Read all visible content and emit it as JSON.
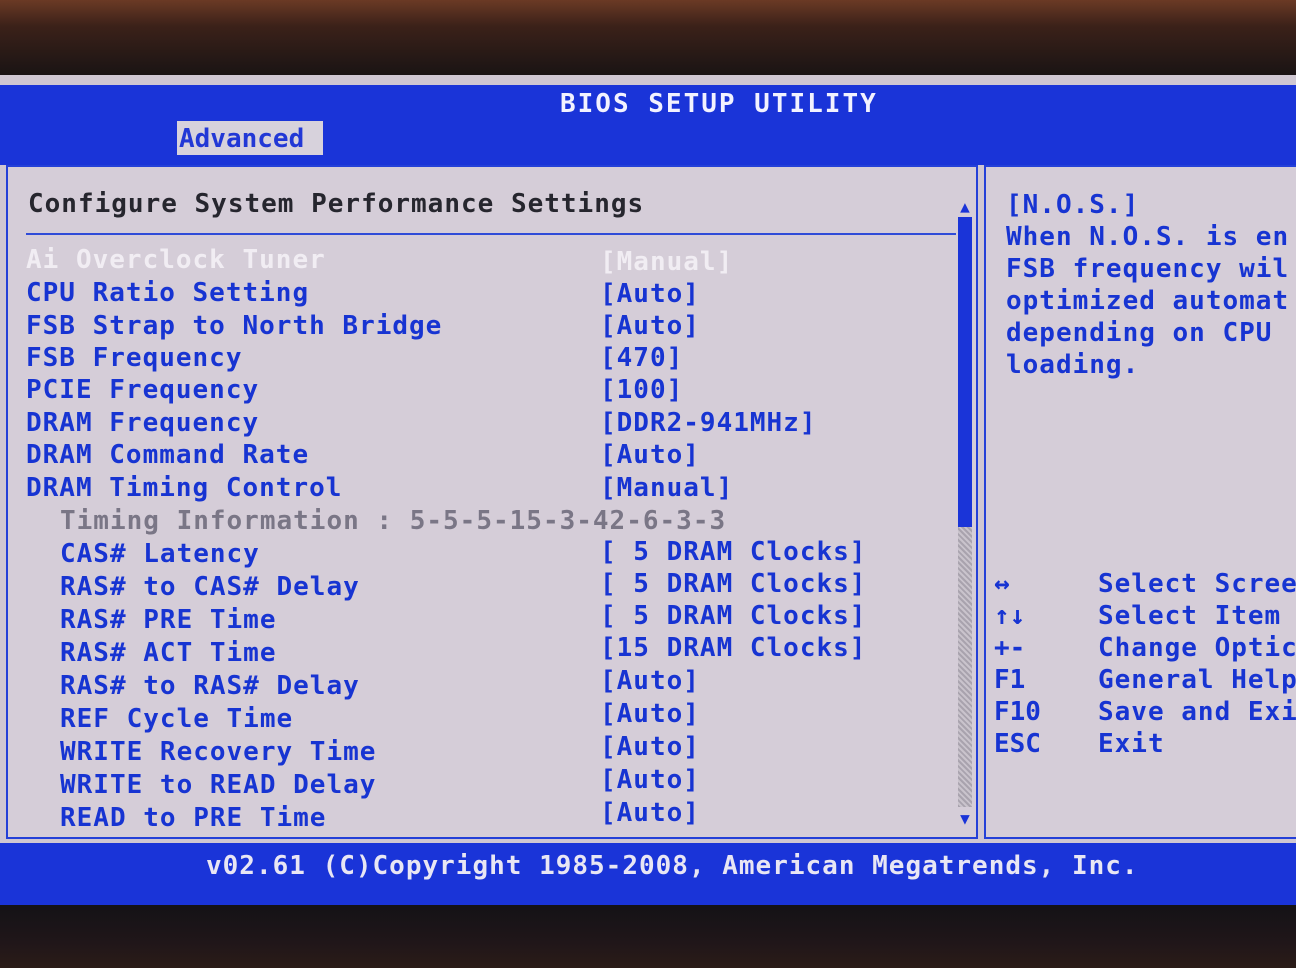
{
  "window": {
    "title": "BIOS SETUP UTILITY",
    "active_tab": "Advanced"
  },
  "main": {
    "heading": "Configure System Performance Settings",
    "items": [
      {
        "label": "Ai Overclock Tuner",
        "value": "[Manual]",
        "state": "selected"
      },
      {
        "label": "CPU Ratio Setting",
        "value": "[Auto]"
      },
      {
        "label": "FSB Strap to North Bridge",
        "value": "[Auto]"
      },
      {
        "label": "FSB Frequency",
        "value": "[470]"
      },
      {
        "label": "PCIE Frequency",
        "value": "[100]"
      },
      {
        "label": "DRAM Frequency",
        "value": "[DDR2-941MHz]"
      },
      {
        "label": "DRAM Command Rate",
        "value": "[Auto]"
      },
      {
        "label": "DRAM Timing Control",
        "value": "[Manual]"
      }
    ],
    "timing_info": "Timing Information : 5-5-5-15-3-42-6-3-3",
    "sub_items": [
      {
        "label": "CAS# Latency",
        "value": "[ 5 DRAM Clocks]"
      },
      {
        "label": "RAS# to CAS# Delay",
        "value": "[ 5 DRAM Clocks]"
      },
      {
        "label": "RAS# PRE Time",
        "value": "[ 5 DRAM Clocks]"
      },
      {
        "label": "RAS# ACT Time",
        "value": "[15 DRAM Clocks]"
      },
      {
        "label": "RAS# to RAS# Delay",
        "value": "[Auto]"
      },
      {
        "label": "REF Cycle Time",
        "value": "[Auto]"
      },
      {
        "label": "WRITE Recovery Time",
        "value": "[Auto]"
      },
      {
        "label": "WRITE to READ Delay",
        "value": "[Auto]"
      },
      {
        "label": "READ to PRE Time",
        "value": "[Auto]"
      }
    ]
  },
  "help": {
    "lines": [
      "[N.O.S.]",
      "When N.O.S. is en",
      "FSB frequency wil",
      "optimized automat",
      "depending on CPU",
      "loading."
    ],
    "keys": [
      {
        "key": "↔",
        "desc": "Select Scree"
      },
      {
        "key": "↑↓",
        "desc": "Select Item"
      },
      {
        "key": "+-",
        "desc": "Change Optic"
      },
      {
        "key": "F1",
        "desc": "General Help"
      },
      {
        "key": "F10",
        "desc": "Save and Exi"
      },
      {
        "key": "ESC",
        "desc": "Exit"
      }
    ]
  },
  "footer": {
    "copyright": "v02.61 (C)Copyright 1985-2008, American Megatrends, Inc."
  },
  "colors": {
    "accent_blue": "#1a34d8",
    "background": "#cfc7d2",
    "selected_text": "#f1edf3"
  }
}
